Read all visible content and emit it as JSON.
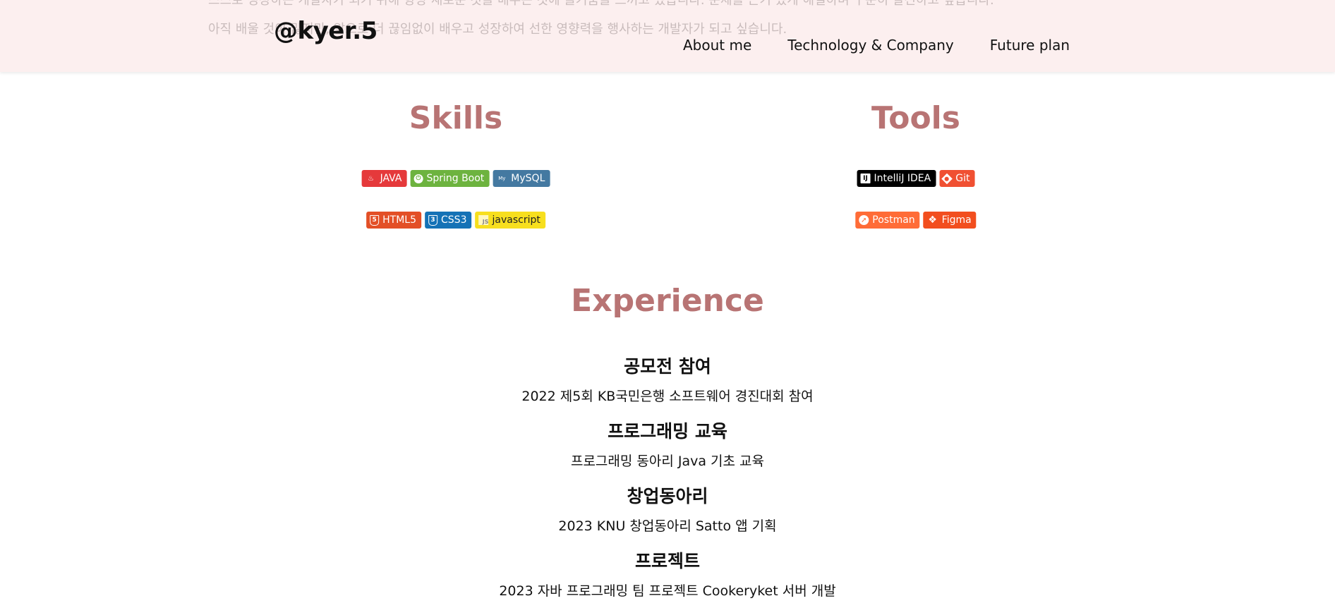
{
  "header": {
    "bg_line_top": "스스로 성장하는 개발자가 되기 위해 항상 새로운 것을 배우는 것에 즐거움을 느끼고 있습니다. 문제를 끈기 있게 해결하며 꾸준히 발전하고 싶습니다.",
    "bg_line": "아직 배울 것이 많지만, 앞으로 더 끊임없이 배우고 성장하여 선한 영향력을 행사하는 개발자가 되고 싶습니다.",
    "logo": "@kyer.5",
    "nav": [
      "About me",
      "Technology & Company",
      "Future plan"
    ]
  },
  "skills": {
    "title": "Skills",
    "row1": [
      {
        "label": "JAVA",
        "icon": "java-icon",
        "color": "#e5393b"
      },
      {
        "label": "Spring Boot",
        "icon": "spring-icon",
        "color": "#6db33f"
      },
      {
        "label": "MySQL",
        "icon": "mysql-icon",
        "color": "#4479a1"
      }
    ],
    "row2": [
      {
        "label": "HTML5",
        "icon": "html5-icon",
        "color": "#e34f26"
      },
      {
        "label": "CSS3",
        "icon": "css3-icon",
        "color": "#1572b6"
      },
      {
        "label": "javascript",
        "icon": "javascript-icon",
        "color": "#f7df1e"
      }
    ]
  },
  "tools": {
    "title": "Tools",
    "row1": [
      {
        "label": "IntelliJ IDEA",
        "icon": "intellij-icon",
        "color": "#000000"
      },
      {
        "label": "Git",
        "icon": "git-icon",
        "color": "#f05032"
      }
    ],
    "row2": [
      {
        "label": "Postman",
        "icon": "postman-icon",
        "color": "#ff6c37"
      },
      {
        "label": "Figma",
        "icon": "figma-icon",
        "color": "#f24e1e"
      }
    ]
  },
  "experience": {
    "title": "Experience",
    "items": [
      {
        "heading": "공모전 참여",
        "detail": "2022 제5회 KB국민은행 소프트웨어 경진대회 참여"
      },
      {
        "heading": "프로그래밍 교육",
        "detail": "프로그래밍 동아리 Java 기초 교육"
      },
      {
        "heading": "창업동아리",
        "detail": "2023 KNU 창업동아리 Satto 앱 기획"
      },
      {
        "heading": "프로젝트",
        "detail": "2023 자바 프로그래밍 팀 프로젝트 Cookeryket 서버 개발"
      }
    ]
  },
  "colors": {
    "accent": "#b87474",
    "header_bg": "#fcefef"
  }
}
